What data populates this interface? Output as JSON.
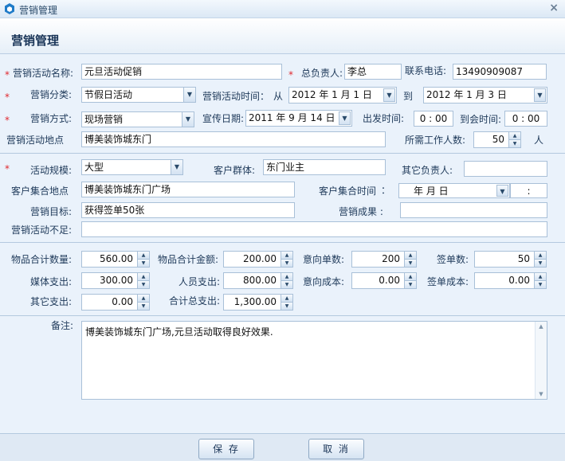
{
  "window": {
    "title": "营销管理",
    "close_glyph": "×",
    "app_icon": "app-logo-icon"
  },
  "header": {
    "title": "营销管理"
  },
  "colors": {
    "required": "#e0282e",
    "accent": "#1a3558",
    "border": "#a9c0d8"
  },
  "required_mark": "*",
  "labels": {
    "activity_name": "营销活动名称:",
    "owner": "总负责人:",
    "phone": "联系电话:",
    "category": "营销分类:",
    "activity_time": "营销活动时间：",
    "from": "从",
    "to": "到",
    "method": "营销方式:",
    "promo_date": "宣传日期:",
    "depart_time": "出发时间:",
    "arrive_time": "到会时间:",
    "location": "营销活动地点",
    "staff_needed": "所需工作人数:",
    "staff_unit": "人",
    "scale": "活动规模:",
    "customer_group": "客户群体:",
    "other_owner": "其它负责人:",
    "gather_place": "客户集合地点",
    "gather_time": "客户集合时间",
    "gather_time_colon": "：",
    "target": "营销目标:",
    "result": "营销成果 :",
    "shortfall": "营销活动不足:",
    "goods_qty": "物品合计数量:",
    "goods_amount": "物品合计金额:",
    "intent_orders": "意向单数:",
    "signed_orders": "签单数:",
    "media_cost": "媒体支出:",
    "staff_cost": "人员支出:",
    "intent_cost": "意向成本:",
    "sign_cost": "签单成本:",
    "other_cost": "其它支出:",
    "total_cost": "合计总支出:",
    "remarks": "备注:"
  },
  "fields": {
    "activity_name": "元旦活动促销",
    "owner": "李总",
    "phone": "13490909087",
    "category": "节假日活动",
    "start_date": "2012 年 1 月 1 日",
    "end_date": "2012 年 1 月 3 日",
    "method": "现场营销",
    "promo_date": "2011 年 9 月 14 日",
    "depart_time": "0 : 00",
    "arrive_time": "0 : 00",
    "location": "博美装饰城东门",
    "staff_needed": "50",
    "scale": "大型",
    "customer_group": "东门业主",
    "other_owner": "",
    "gather_place": "博美装饰城东门广场",
    "gather_date": "年   月   日",
    "gather_clock": ":",
    "target": "获得签单50张",
    "result": "",
    "shortfall": "",
    "goods_qty": "560.00",
    "goods_amount": "200.00",
    "intent_orders": "200",
    "signed_orders": "50",
    "media_cost": "300.00",
    "staff_cost": "800.00",
    "intent_cost": "0.00",
    "sign_cost": "0.00",
    "other_cost": "0.00",
    "total_cost": "1,300.00",
    "remarks": "博美装饰城东门广场,元旦活动取得良好效果."
  },
  "buttons": {
    "save": "保 存",
    "cancel": "取 消"
  },
  "glyphs": {
    "dropdown": "▼",
    "spin_up": "▲",
    "spin_down": "▼"
  }
}
